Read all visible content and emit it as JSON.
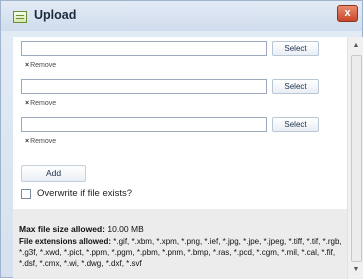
{
  "window": {
    "title": "Upload",
    "close_label": "x"
  },
  "uploads": [
    {
      "value": "",
      "select_label": "Select",
      "remove_label": "Remove"
    },
    {
      "value": "",
      "select_label": "Select",
      "remove_label": "Remove"
    },
    {
      "value": "",
      "select_label": "Select",
      "remove_label": "Remove"
    }
  ],
  "add_label": "Add",
  "overwrite": {
    "label": "Overwrite if file exists?",
    "checked": false
  },
  "info": {
    "max_size_label": "Max file size allowed:",
    "max_size_value": "10.00 MB",
    "extensions_label": "File extensions allowed:",
    "extensions_value": "*.gif, *.xbm, *.xpm, *.png, *.ief, *.jpg, *.jpe, *.jpeg, *.tiff, *.tif, *.rgb, *.g3f, *.xwd, *.pict, *.ppm, *.pgm, *.pbm, *.pnm, *.bmp, *.ras, *.pcd, *.cgm, *.mil, *.cal, *.fif, *.dsf, *.cmx, *.wi, *.dwg, *.dxf, *.svf"
  },
  "colors": {
    "titlebar": "#dbe6f3",
    "close_button": "#d9604a",
    "info_panel": "#ececec"
  },
  "icons": {
    "app": "upload-window-icon",
    "close": "close-icon",
    "remove": "x-icon"
  }
}
